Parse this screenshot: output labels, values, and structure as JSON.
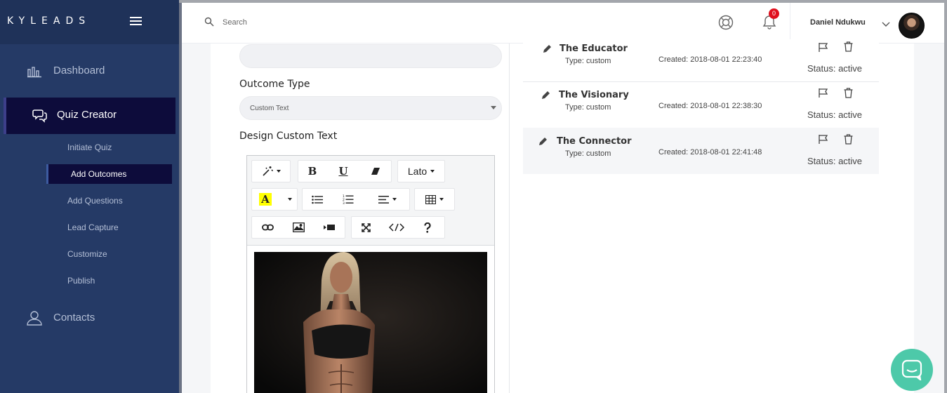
{
  "brand": {
    "name": "KYLEADS"
  },
  "sidebar": {
    "items": [
      {
        "label": "Dashboard",
        "icon": "bar-chart-icon"
      },
      {
        "label": "Quiz Creator",
        "icon": "chat-bubbles-icon"
      },
      {
        "label": "Contacts",
        "icon": "person-icon"
      }
    ],
    "sub_items": [
      {
        "label": "Initiate Quiz"
      },
      {
        "label": "Add Outcomes"
      },
      {
        "label": "Add Questions"
      },
      {
        "label": "Lead Capture"
      },
      {
        "label": "Customize"
      },
      {
        "label": "Publish"
      }
    ]
  },
  "topbar": {
    "search_placeholder": "Search",
    "notification_count": "0",
    "user_name": "Daniel Ndukwu"
  },
  "form": {
    "outcome_type_label": "Outcome Type",
    "outcome_type_value": "Custom Text",
    "design_label": "Design Custom Text",
    "font_select": "Lato"
  },
  "outcomes": [
    {
      "name": "The Educator",
      "type": "Type: custom",
      "created": "Created: 2018-08-01 22:23:40",
      "status": "Status: active"
    },
    {
      "name": "The Visionary",
      "type": "Type: custom",
      "created": "Created: 2018-08-01 22:38:30",
      "status": "Status: active"
    },
    {
      "name": "The Connector",
      "type": "Type: custom",
      "created": "Created: 2018-08-01 22:41:48",
      "status": "Status: active"
    }
  ],
  "colors": {
    "sidebar_bg": "#253a66",
    "active_bg": "#0d0c3b",
    "badge": "#e0101e",
    "chat": "#4dc9a9"
  }
}
